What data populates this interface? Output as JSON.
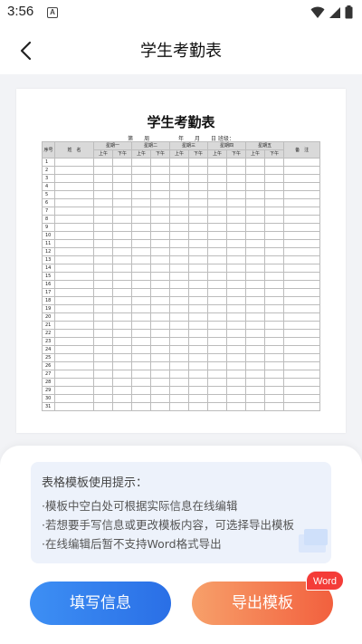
{
  "status_bar": {
    "time": "3:56",
    "notif_letter": "A"
  },
  "header": {
    "title": "学生考勤表"
  },
  "sheet": {
    "title": "学生考勤表",
    "meta": "第____周  __________年____月____日          班级：",
    "header_row1": {
      "seq": "序号",
      "name": "姓　名",
      "remark": "备　注"
    },
    "days": [
      "星期一",
      "星期二",
      "星期三",
      "星期四",
      "星期五"
    ],
    "am": "上午",
    "pm": "下午",
    "rows": [
      "1",
      "2",
      "3",
      "4",
      "5",
      "6",
      "7",
      "8",
      "9",
      "10",
      "11",
      "12",
      "13",
      "14",
      "15",
      "16",
      "17",
      "18",
      "19",
      "20",
      "21",
      "22",
      "23",
      "24",
      "25",
      "26",
      "27",
      "28",
      "29",
      "30",
      "31"
    ]
  },
  "tips": {
    "title": "表格模板使用提示：",
    "lines": [
      "·模板中空白处可根据实际信息在线编辑",
      "·若想要手写信息或更改模板内容，可选择导出模板",
      "·在线编辑后暂不支持Word格式导出"
    ]
  },
  "buttons": {
    "fill": "填写信息",
    "export": "导出模板",
    "word_badge": "Word"
  },
  "colors": {
    "fill_button": "#2f7aee",
    "export_button": "#f46a44",
    "word_badge": "#f43c38",
    "tips_bg": "#edf2fb"
  }
}
